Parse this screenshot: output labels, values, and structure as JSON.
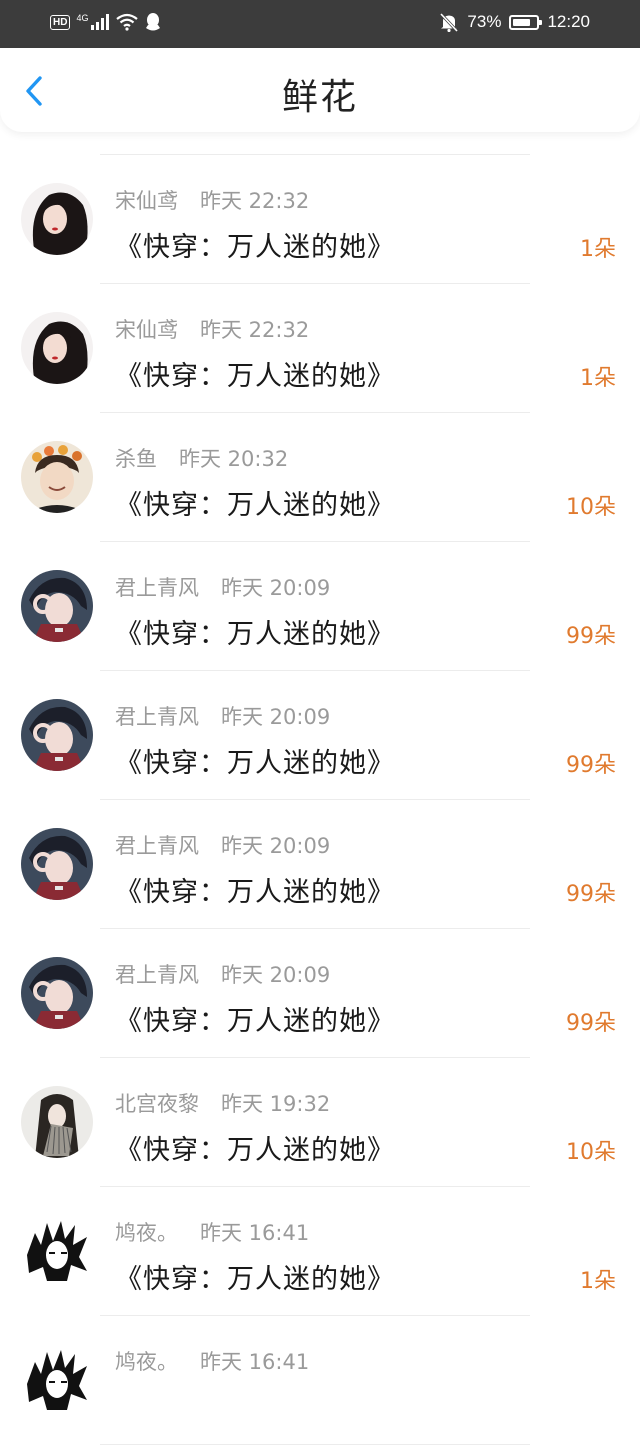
{
  "status_bar": {
    "hd": "HD",
    "network": "4G",
    "battery_percent": "73%",
    "battery_level": 0.73,
    "time": "12:20",
    "icons": [
      "signal-icon",
      "wifi-icon",
      "qq-icon",
      "mute-bell-icon",
      "battery-icon"
    ]
  },
  "header": {
    "title": "鲜花",
    "back_icon": "chevron-left-icon",
    "accent_color": "#2196f3"
  },
  "colors": {
    "name_time": "#9a9a9a",
    "book_title": "#1a1a1a",
    "amount": "#e07a2e"
  },
  "entries": [
    {
      "name": "宋仙鸢",
      "time": "昨天 22:32",
      "book": "《快穿：万人迷的她》",
      "amount": "1朵",
      "avatar": "girl-dark-hair"
    },
    {
      "name": "宋仙鸢",
      "time": "昨天 22:32",
      "book": "《快穿：万人迷的她》",
      "amount": "1朵",
      "avatar": "girl-dark-hair"
    },
    {
      "name": "杀鱼",
      "time": "昨天 20:32",
      "book": "《快穿：万人迷的她》",
      "amount": "10朵",
      "avatar": "boy-flower-crown"
    },
    {
      "name": "君上青风",
      "time": "昨天 20:09",
      "book": "《快穿：万人迷的她》",
      "amount": "99朵",
      "avatar": "anime-ok-sign"
    },
    {
      "name": "君上青风",
      "time": "昨天 20:09",
      "book": "《快穿：万人迷的她》",
      "amount": "99朵",
      "avatar": "anime-ok-sign"
    },
    {
      "name": "君上青风",
      "time": "昨天 20:09",
      "book": "《快穿：万人迷的她》",
      "amount": "99朵",
      "avatar": "anime-ok-sign"
    },
    {
      "name": "君上青风",
      "time": "昨天 20:09",
      "book": "《快穿：万人迷的她》",
      "amount": "99朵",
      "avatar": "anime-ok-sign"
    },
    {
      "name": "北宫夜黎",
      "time": "昨天 19:32",
      "book": "《快穿：万人迷的她》",
      "amount": "10朵",
      "avatar": "anime-fan"
    },
    {
      "name": "鸠夜。",
      "time": "昨天 16:41",
      "book": "《快穿：万人迷的她》",
      "amount": "1朵",
      "avatar": "anime-sketch"
    },
    {
      "name": "鸠夜。",
      "time": "昨天 16:41",
      "book": "",
      "amount": "",
      "avatar": "anime-sketch"
    }
  ]
}
